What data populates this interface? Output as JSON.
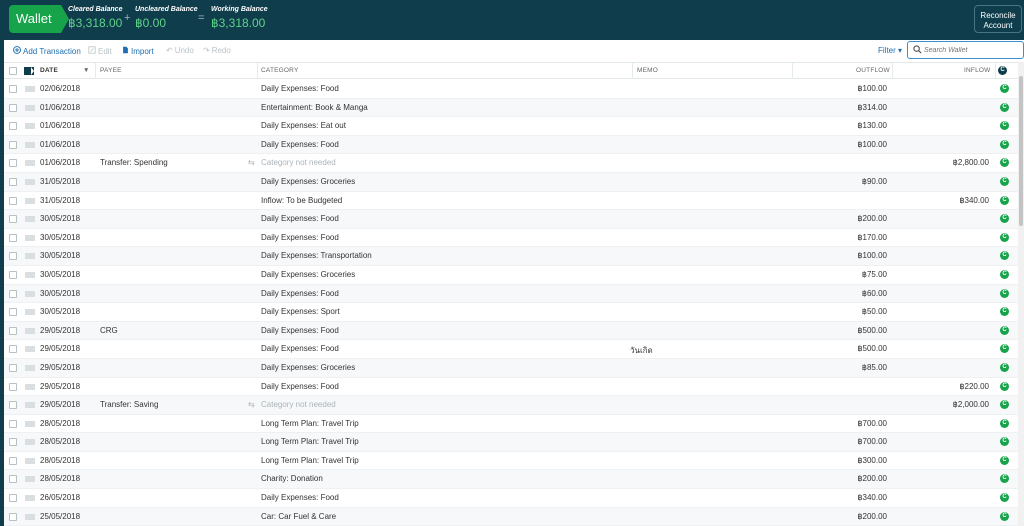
{
  "header": {
    "account_name": "Wallet",
    "cleared_label": "Cleared Balance",
    "cleared_amount": "฿3,318.00",
    "uncleared_label": "Uncleared Balance",
    "uncleared_amount": "฿0.00",
    "working_label": "Working Balance",
    "working_amount": "฿3,318.00",
    "plus": "+",
    "equals": "=",
    "reconcile_line1": "Reconcile",
    "reconcile_line2": "Account"
  },
  "toolbar": {
    "add": "Add Transaction",
    "edit": "Edit",
    "import": "Import",
    "undo": "Undo",
    "redo": "Redo",
    "filter": "Filter ▾",
    "search_placeholder": "Search Wallet"
  },
  "columns": {
    "date": "DATE",
    "payee": "PAYEE",
    "category": "CATEGORY",
    "memo": "MEMO",
    "outflow": "OUTFLOW",
    "inflow": "INFLOW",
    "cleared": "C"
  },
  "colors": {
    "header_bg": "#0f3d4c",
    "accent_green": "#16a34a",
    "balance_green": "#5fd38a",
    "link_blue": "#1f6fb0"
  },
  "transactions": [
    {
      "date": "02/06/2018",
      "payee": "",
      "category": "Daily Expenses: Food",
      "memo": "",
      "outflow": "฿100.00",
      "inflow": "",
      "transfer": false
    },
    {
      "date": "01/06/2018",
      "payee": "",
      "category": "Entertainment: Book & Manga",
      "memo": "",
      "outflow": "฿314.00",
      "inflow": "",
      "transfer": false
    },
    {
      "date": "01/06/2018",
      "payee": "",
      "category": "Daily Expenses: Eat out",
      "memo": "",
      "outflow": "฿130.00",
      "inflow": "",
      "transfer": false
    },
    {
      "date": "01/06/2018",
      "payee": "",
      "category": "Daily Expenses: Food",
      "memo": "",
      "outflow": "฿100.00",
      "inflow": "",
      "transfer": false
    },
    {
      "date": "01/06/2018",
      "payee": "Transfer: Spending",
      "category": "Category not needed",
      "memo": "",
      "outflow": "",
      "inflow": "฿2,800.00",
      "transfer": true
    },
    {
      "date": "31/05/2018",
      "payee": "",
      "category": "Daily Expenses: Groceries",
      "memo": "",
      "outflow": "฿90.00",
      "inflow": "",
      "transfer": false
    },
    {
      "date": "31/05/2018",
      "payee": "",
      "category": "Inflow: To be Budgeted",
      "memo": "",
      "outflow": "",
      "inflow": "฿340.00",
      "transfer": false
    },
    {
      "date": "30/05/2018",
      "payee": "",
      "category": "Daily Expenses: Food",
      "memo": "",
      "outflow": "฿200.00",
      "inflow": "",
      "transfer": false
    },
    {
      "date": "30/05/2018",
      "payee": "",
      "category": "Daily Expenses: Food",
      "memo": "",
      "outflow": "฿170.00",
      "inflow": "",
      "transfer": false
    },
    {
      "date": "30/05/2018",
      "payee": "",
      "category": "Daily Expenses: Transportation",
      "memo": "",
      "outflow": "฿100.00",
      "inflow": "",
      "transfer": false
    },
    {
      "date": "30/05/2018",
      "payee": "",
      "category": "Daily Expenses: Groceries",
      "memo": "",
      "outflow": "฿75.00",
      "inflow": "",
      "transfer": false
    },
    {
      "date": "30/05/2018",
      "payee": "",
      "category": "Daily Expenses: Food",
      "memo": "",
      "outflow": "฿60.00",
      "inflow": "",
      "transfer": false
    },
    {
      "date": "30/05/2018",
      "payee": "",
      "category": "Daily Expenses: Sport",
      "memo": "",
      "outflow": "฿50.00",
      "inflow": "",
      "transfer": false
    },
    {
      "date": "29/05/2018",
      "payee": "CRG",
      "category": "Daily Expenses: Food",
      "memo": "",
      "outflow": "฿500.00",
      "inflow": "",
      "transfer": false
    },
    {
      "date": "29/05/2018",
      "payee": "",
      "category": "Daily Expenses: Food",
      "memo": "วันเกิด",
      "outflow": "฿500.00",
      "inflow": "",
      "transfer": false
    },
    {
      "date": "29/05/2018",
      "payee": "",
      "category": "Daily Expenses: Groceries",
      "memo": "",
      "outflow": "฿85.00",
      "inflow": "",
      "transfer": false
    },
    {
      "date": "29/05/2018",
      "payee": "",
      "category": "Daily Expenses: Food",
      "memo": "",
      "outflow": "",
      "inflow": "฿220.00",
      "transfer": false
    },
    {
      "date": "29/05/2018",
      "payee": "Transfer: Saving",
      "category": "Category not needed",
      "memo": "",
      "outflow": "",
      "inflow": "฿2,000.00",
      "transfer": true
    },
    {
      "date": "28/05/2018",
      "payee": "",
      "category": "Long Term Plan: Travel Trip",
      "memo": "",
      "outflow": "฿700.00",
      "inflow": "",
      "transfer": false
    },
    {
      "date": "28/05/2018",
      "payee": "",
      "category": "Long Term Plan: Travel Trip",
      "memo": "",
      "outflow": "฿700.00",
      "inflow": "",
      "transfer": false
    },
    {
      "date": "28/05/2018",
      "payee": "",
      "category": "Long Term Plan: Travel Trip",
      "memo": "",
      "outflow": "฿300.00",
      "inflow": "",
      "transfer": false
    },
    {
      "date": "28/05/2018",
      "payee": "",
      "category": "Charity: Donation",
      "memo": "",
      "outflow": "฿200.00",
      "inflow": "",
      "transfer": false
    },
    {
      "date": "26/05/2018",
      "payee": "",
      "category": "Daily Expenses: Food",
      "memo": "",
      "outflow": "฿340.00",
      "inflow": "",
      "transfer": false
    },
    {
      "date": "25/05/2018",
      "payee": "",
      "category": "Car: Car Fuel & Care",
      "memo": "",
      "outflow": "฿200.00",
      "inflow": "",
      "transfer": false
    }
  ]
}
